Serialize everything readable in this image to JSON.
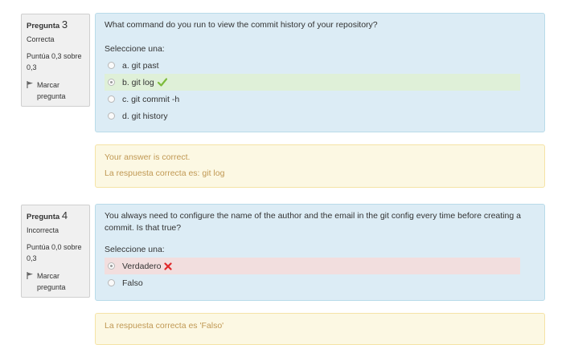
{
  "colors": {
    "info_bg": "#f0f0f0",
    "formulation_bg": "#dcecf5",
    "feedback_bg": "#fcf8e3",
    "feedback_text": "#c09853",
    "correct_bg": "#dff0d8",
    "incorrect_bg": "#f2dede",
    "check_color": "#7dbb3c",
    "cross_color": "#e0292a"
  },
  "q3": {
    "info": {
      "label": "Pregunta",
      "number": "3",
      "state": "Correcta",
      "grade": "Puntúa 0,3 sobre 0,3",
      "flag": "Marcar pregunta",
      "flag_icon": "flag-icon"
    },
    "text": "What command do you run to view the commit history of your repository?",
    "prompt": "Seleccione una:",
    "options": [
      {
        "label": "a. git past",
        "checked": false
      },
      {
        "label": "b. git log",
        "checked": true,
        "status": "correct",
        "icon": "check-icon"
      },
      {
        "label": "c. git commit -h",
        "checked": false
      },
      {
        "label": "d. git history",
        "checked": false
      }
    ],
    "feedback": {
      "specific": "Your answer is correct.",
      "right_answer": "La respuesta correcta es: git log"
    }
  },
  "q4": {
    "info": {
      "label": "Pregunta",
      "number": "4",
      "state": "Incorrecta",
      "grade": "Puntúa 0,0 sobre 0,3",
      "flag": "Marcar pregunta",
      "flag_icon": "flag-icon"
    },
    "text": "You always need to configure the name of the author and the email in the git config every time before creating a commit. Is that true?",
    "prompt": "Seleccione una:",
    "options": [
      {
        "label": "Verdadero",
        "checked": true,
        "status": "incorrect",
        "icon": "cross-icon"
      },
      {
        "label": "Falso",
        "checked": false
      }
    ],
    "feedback": {
      "right_answer": "La respuesta correcta es 'Falso'"
    }
  }
}
